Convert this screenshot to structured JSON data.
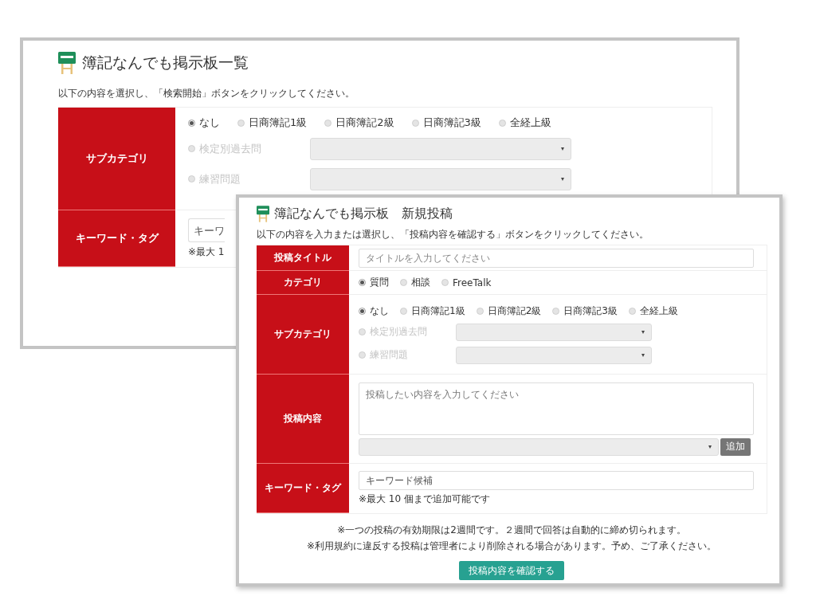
{
  "list_window": {
    "title": "簿記なんでも掲示板一覧",
    "instruction": "以下の内容を選択し、「検索開始」ボタンをクリックしてください。",
    "subcategory": {
      "label": "サブカテゴリ",
      "options": [
        {
          "label": "なし",
          "selected": true
        },
        {
          "label": "日商簿記1級",
          "selected": false
        },
        {
          "label": "日商簿記2級",
          "selected": false
        },
        {
          "label": "日商簿記3級",
          "selected": false
        },
        {
          "label": "全経上級",
          "selected": false
        }
      ],
      "choices": [
        {
          "label": "検定別過去問",
          "selected": false,
          "disabled": true
        },
        {
          "label": "練習問題",
          "selected": false,
          "disabled": true
        }
      ]
    },
    "keyword": {
      "label": "キーワード・タグ",
      "placeholder": "キーワ",
      "hint": "※最大 1"
    }
  },
  "post_window": {
    "title": "簿記なんでも掲示板　新規投稿",
    "instruction": "以下の内容を入力または選択し、「投稿内容を確認する」ボタンをクリックしてください。",
    "post_title": {
      "label": "投稿タイトル",
      "placeholder": "タイトルを入力してください"
    },
    "category": {
      "label": "カテゴリ",
      "options": [
        {
          "label": "質問",
          "selected": true
        },
        {
          "label": "相談",
          "selected": false
        },
        {
          "label": "FreeTalk",
          "selected": false
        }
      ]
    },
    "subcategory": {
      "label": "サブカテゴリ",
      "options": [
        {
          "label": "なし",
          "selected": true
        },
        {
          "label": "日商簿記1級",
          "selected": false
        },
        {
          "label": "日商簿記2級",
          "selected": false
        },
        {
          "label": "日商簿記3級",
          "selected": false
        },
        {
          "label": "全経上級",
          "selected": false
        }
      ],
      "choices": [
        {
          "label": "検定別過去問",
          "selected": false,
          "disabled": true
        },
        {
          "label": "練習問題",
          "selected": false,
          "disabled": true
        }
      ]
    },
    "content": {
      "label": "投稿内容",
      "placeholder": "投稿したい内容を入力してください",
      "add_button": "追加"
    },
    "keyword": {
      "label": "キーワード・タグ",
      "placeholder": "キーワード候補",
      "hint": "※最大 10 個まで追加可能です"
    },
    "notes": [
      "※一つの投稿の有効期限は2週間です。２週間で回答は自動的に締め切られます。",
      "※利用規約に違反する投稿は管理者により削除される場合があります。予め、ご了承ください。"
    ],
    "confirm_button": "投稿内容を確認する"
  }
}
